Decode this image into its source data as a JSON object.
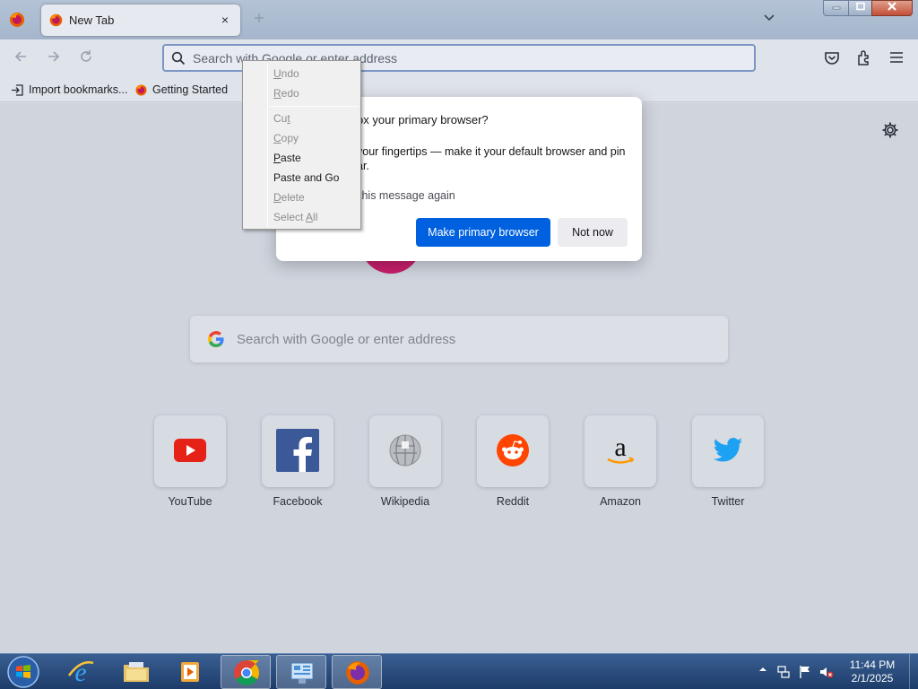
{
  "browser": {
    "tab_title": "New Tab",
    "tab_close": "×",
    "new_tab": "+",
    "url_placeholder": "Search with Google or enter address"
  },
  "bookmarks": [
    {
      "label": "Import bookmarks..."
    },
    {
      "label": "Getting Started"
    }
  ],
  "newtab": {
    "search_placeholder": "Search with Google or enter address",
    "top_sites": [
      {
        "label": "YouTube"
      },
      {
        "label": "Facebook"
      },
      {
        "label": "Wikipedia"
      },
      {
        "label": "Reddit"
      },
      {
        "label": "Amazon"
      },
      {
        "label": "Twitter"
      }
    ]
  },
  "dialog": {
    "title": "ox your primary browser?",
    "body_line1": " your fingertips — make it your default browser and pin",
    "body_line2": "ar.",
    "checkbox_label": "this message again",
    "primary_button": "Make primary browser",
    "secondary_button": "Not now"
  },
  "context_menu": {
    "items": [
      {
        "label": "Undo",
        "mnemonic": "U",
        "rest": "ndo",
        "enabled": false
      },
      {
        "label": "Redo",
        "mnemonic": "R",
        "rest": "edo",
        "enabled": false
      },
      {
        "label": "Cut",
        "pre": "Cu",
        "mnemonic": "t",
        "enabled": false
      },
      {
        "label": "Copy",
        "mnemonic": "C",
        "rest": "opy",
        "enabled": false
      },
      {
        "label": "Paste",
        "mnemonic": "P",
        "rest": "aste",
        "enabled": true
      },
      {
        "label": "Paste and Go",
        "enabled": true
      },
      {
        "label": "Delete",
        "mnemonic": "D",
        "rest": "elete",
        "enabled": false
      },
      {
        "label": "Select All",
        "pre": "Select ",
        "mnemonic": "A",
        "rest": "ll",
        "enabled": false
      }
    ]
  },
  "taskbar": {
    "time": "11:44 PM",
    "date": "2/1/2025"
  },
  "colors": {
    "accent": "#0061e0",
    "taskbar": "#1d3c6a"
  }
}
